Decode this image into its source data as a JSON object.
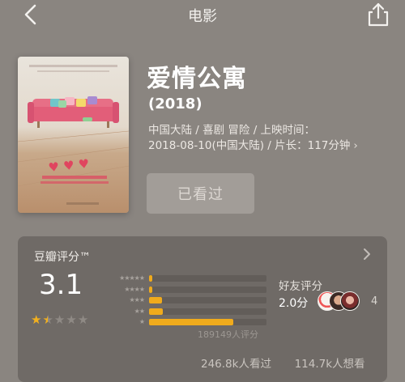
{
  "header": {
    "title": "电影"
  },
  "movie": {
    "name": "爱情公寓",
    "year": "(2018)",
    "info_line1": "中国大陆 / 喜剧 冒险 / 上映时间：",
    "info_line2": "2018-08-10(中国大陆) / 片长：117分钟",
    "watched_button": "已看过"
  },
  "rating": {
    "title": "豆瓣评分™",
    "score": "3.1",
    "stars": 1.5,
    "distribution": [
      {
        "stars": 5,
        "fraction": 0.03
      },
      {
        "stars": 4,
        "fraction": 0.03
      },
      {
        "stars": 3,
        "fraction": 0.11
      },
      {
        "stars": 2,
        "fraction": 0.12
      },
      {
        "stars": 1,
        "fraction": 0.72
      }
    ],
    "count": "189149人评分",
    "friend_label": "好友评分",
    "friend_score": "2.0分",
    "friend_count": "4",
    "watched": "246.8k人看过",
    "wish": "114.7k人想看"
  },
  "colors": {
    "background": "#8a8580",
    "card": "#6f6a66",
    "accent": "#f0ab1c"
  }
}
